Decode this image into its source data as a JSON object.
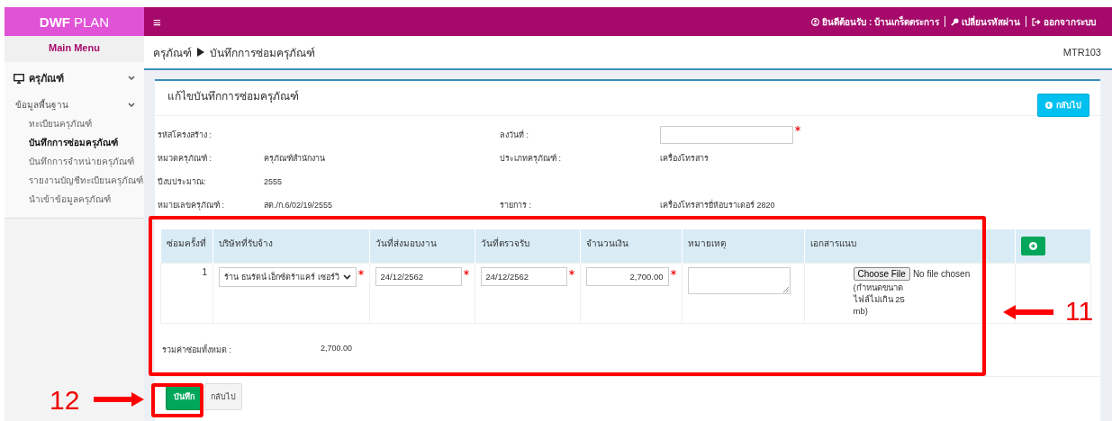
{
  "app": {
    "logo_bold": "DWF",
    "logo_rest": "PLAN"
  },
  "top_bar": {
    "menu_icon": "≡",
    "user": "ยินดีต้อนรับ : บ้านเกร็ดตระการ",
    "change_password": "เปลี่ยนรหัสผ่าน",
    "logout": "ออกจากระบบ"
  },
  "sidebar": {
    "title": "Main Menu",
    "group": {
      "label": "ครุภัณฑ์",
      "expanded": true
    },
    "subgroup": {
      "label": "ข้อมูลพื้นฐาน",
      "expanded": true
    },
    "items": [
      {
        "label": "ทะเบียนครุภัณฑ์",
        "selected": false
      },
      {
        "label": "บันทึกการซ่อมครุภัณฑ์",
        "selected": true
      },
      {
        "label": "บันทึกการจำหน่ายครุภัณฑ์",
        "selected": false
      },
      {
        "label": "รายงานบัญชีทะเบียนครุภัณฑ์",
        "selected": false
      },
      {
        "label": "นำเข้าข้อมูลครุภัณฑ์",
        "selected": false
      }
    ]
  },
  "breadcrumb": [
    "ครุภัณฑ์",
    "บันทึกการซ่อมครุภัณฑ์"
  ],
  "page_code": "MTR103",
  "card": {
    "title": "แก้ไขบันทึกการซ่อมครุภัณฑ์",
    "back_button": "กลับไป"
  },
  "form_rows": [
    {
      "left": {
        "label": "รหัสโครงสร้าง :"
      },
      "right": {
        "label": "ลงวันที่ :",
        "kind": "input",
        "required": true
      }
    },
    {
      "left": {
        "label": "หมวดครุภัณฑ์ :",
        "value": "ครุภัณฑ์สำนักงาน"
      },
      "right": {
        "label": "ประเภทครุภัณฑ์ :",
        "value": "เครื่องโทรสาร"
      }
    },
    {
      "left": {
        "label": "ปีงบประมาณ:",
        "value": "2555"
      }
    },
    {
      "left": {
        "label": "หมายเลขครุภัณฑ์ :",
        "value": "สต./ก.6/02/19/2555"
      },
      "right": {
        "label": "รายการ :",
        "value": "เครื่องโทรสารยี่ห้อบราเดอร์ 2820"
      }
    }
  ],
  "table": {
    "columns": [
      "ซ่อมครั้งที่",
      "บริษัทที่รับจ้าง",
      "วันที่ส่งมอบงาน",
      "วันที่ตรวจรับ",
      "จำนวนเงิน",
      "หมายเหตุ",
      "เอกสารแนบ"
    ],
    "rows": [
      {
        "number": "1",
        "company": "ร้าน ธนรัตน์ เอ็กซ์ตร้าแคร์ เซอร์วิ",
        "delivery_date": "24/12/2562",
        "inspection_date": "24/12/2562",
        "amount": "2,700.00",
        "file_button": "Choose File",
        "file_status": "No file chosen",
        "file_hint": "(กำหนดขนาดไฟล์ไม่เกิน 25 mb)"
      }
    ]
  },
  "total": {
    "label": "รวมค่าซ่อมทั้งหมด :",
    "value": "2,700.00"
  },
  "footer": {
    "save_button": "บันทึก",
    "back_button": "กลับไป"
  },
  "annotations": [
    "11",
    "12"
  ]
}
